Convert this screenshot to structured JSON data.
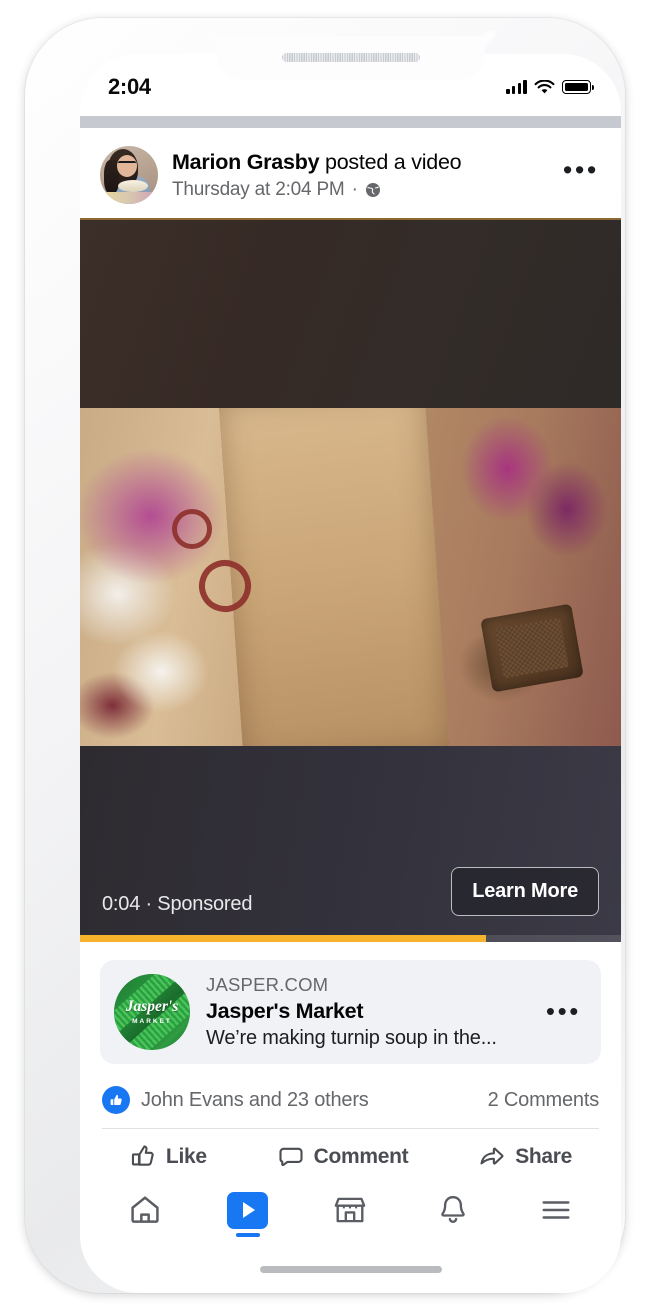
{
  "status_bar": {
    "time": "2:04",
    "signal_icon": "cellular-signal-icon",
    "wifi_icon": "wifi-icon",
    "battery_icon": "battery-full-icon"
  },
  "post": {
    "author": "Marion Grasby",
    "action": " posted a video",
    "timestamp": "Thursday at 2:04 PM",
    "separator": "·",
    "privacy_icon": "globe-icon",
    "more_options": "•••",
    "avatar_name": "marion-grasby-avatar"
  },
  "video": {
    "duration": "0:04",
    "sponsored_separator": "·",
    "sponsored_label": "Sponsored",
    "overlay_text": "0:04 · Sponsored",
    "cta_label": "Learn More",
    "progress_percent": 75,
    "progress_color": "#f7b32b"
  },
  "link_card": {
    "domain": "JASPER.COM",
    "title": "Jasper's Market",
    "description": "We’re making turnip soup in the...",
    "more_options": "•••",
    "logo_name": "Jasper's",
    "logo_sub": "MARKET",
    "logo_color": "#1d7a33"
  },
  "reactions": {
    "like_icon": "thumbs-up-filled-icon",
    "summary": "John Evans and 23 others",
    "comments": "2 Comments",
    "accent_color": "#1877f2"
  },
  "actions": [
    {
      "label": "Like",
      "icon": "thumbs-up-outline-icon"
    },
    {
      "label": "Comment",
      "icon": "speech-bubble-icon"
    },
    {
      "label": "Share",
      "icon": "share-arrow-icon"
    }
  ],
  "bottom_nav": [
    {
      "name": "home",
      "icon": "home-icon",
      "active": false
    },
    {
      "name": "watch",
      "icon": "video-play-icon",
      "active": true
    },
    {
      "name": "marketplace",
      "icon": "storefront-icon",
      "active": false
    },
    {
      "name": "notifications",
      "icon": "bell-icon",
      "active": false
    },
    {
      "name": "menu",
      "icon": "hamburger-menu-icon",
      "active": false
    }
  ]
}
